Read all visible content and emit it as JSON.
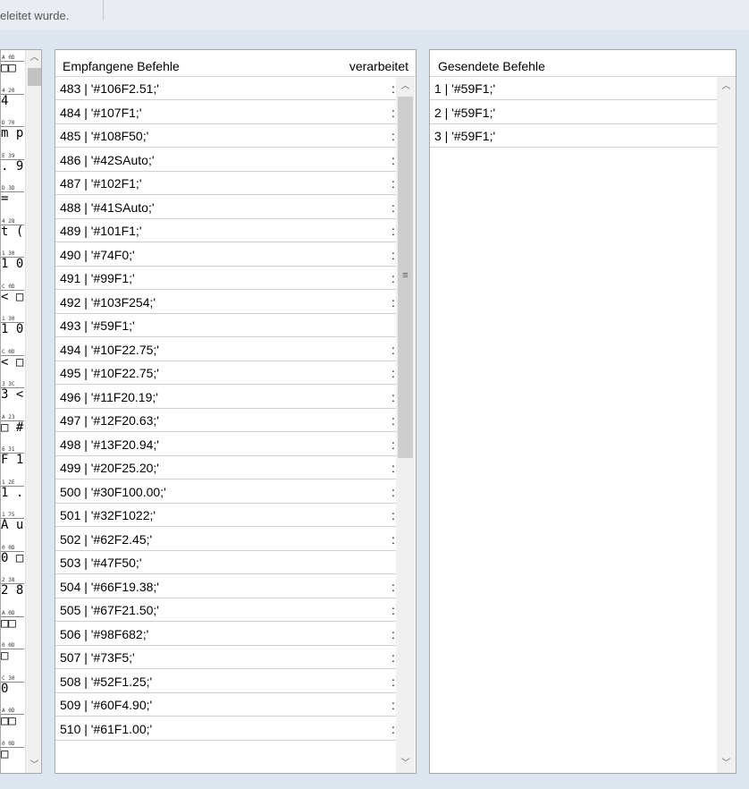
{
  "status_text": "eleitet wurde.",
  "hex_column": [
    {
      "hex": "A 0D",
      "char": "□□"
    },
    {
      "hex": "4 20",
      "char": "4"
    },
    {
      "hex": "D 70",
      "char": "m p"
    },
    {
      "hex": "E 39",
      "char": ". 9"
    },
    {
      "hex": "D 3D",
      "char": " ="
    },
    {
      "hex": "4 28",
      "char": "t ("
    },
    {
      "hex": "1 30",
      "char": "1 0"
    },
    {
      "hex": "C 0D",
      "char": "< □"
    },
    {
      "hex": "1 30",
      "char": "1 0"
    },
    {
      "hex": "C 0D",
      "char": "< □"
    },
    {
      "hex": "3 3C",
      "char": "3 <"
    },
    {
      "hex": "A 23",
      "char": "□ #"
    },
    {
      "hex": "6 31",
      "char": "F 1"
    },
    {
      "hex": "1 2E",
      "char": "1 ."
    },
    {
      "hex": "1 75",
      "char": "A u"
    },
    {
      "hex": "0 0D",
      "char": "0 □"
    },
    {
      "hex": "2 38",
      "char": "2 8"
    },
    {
      "hex": "A 0D",
      "char": "□□"
    },
    {
      "hex": "0 0D",
      "char": " □"
    },
    {
      "hex": "C 30",
      "char": " 0"
    },
    {
      "hex": "A 0D",
      "char": "□□"
    },
    {
      "hex": "0 0D",
      "char": " □"
    }
  ],
  "received": {
    "header_title": "Empfangene Befehle",
    "header_processed": "verarbeitet",
    "rows": [
      {
        "text": "483 | '#106F2.51;'",
        "processed": true
      },
      {
        "text": "484 | '#107F1;'",
        "processed": true
      },
      {
        "text": "485 | '#108F50;'",
        "processed": true
      },
      {
        "text": "486 | '#42SAuto;'",
        "processed": true
      },
      {
        "text": "487 | '#102F1;'",
        "processed": true
      },
      {
        "text": "488 | '#41SAuto;'",
        "processed": true
      },
      {
        "text": "489 | '#101F1;'",
        "processed": true
      },
      {
        "text": "490 | '#74F0;'",
        "processed": true
      },
      {
        "text": "491 | '#99F1;'",
        "processed": true
      },
      {
        "text": "492 | '#103F254;'",
        "processed": true
      },
      {
        "text": "493 | '#59F1;'",
        "processed": false
      },
      {
        "text": "494 | '#10F22.75;'",
        "processed": true
      },
      {
        "text": "495 | '#10F22.75;'",
        "processed": true
      },
      {
        "text": "496 | '#11F20.19;'",
        "processed": true
      },
      {
        "text": "497 | '#12F20.63;'",
        "processed": true
      },
      {
        "text": "498 | '#13F20.94;'",
        "processed": true
      },
      {
        "text": "499 | '#20F25.20;'",
        "processed": true
      },
      {
        "text": "500 | '#30F100.00;'",
        "processed": true
      },
      {
        "text": "501 | '#32F1022;'",
        "processed": true
      },
      {
        "text": "502 | '#62F2.45;'",
        "processed": true
      },
      {
        "text": "503 | '#47F50;'",
        "processed": false
      },
      {
        "text": "504 | '#66F19.38;'",
        "processed": true
      },
      {
        "text": "505 | '#67F21.50;'",
        "processed": true
      },
      {
        "text": "506 | '#98F682;'",
        "processed": true
      },
      {
        "text": "507 | '#73F5;'",
        "processed": true
      },
      {
        "text": "508 | '#52F1.25;'",
        "processed": true
      },
      {
        "text": "509 | '#60F4.90;'",
        "processed": true
      },
      {
        "text": "510 | '#61F1.00;'",
        "processed": true
      }
    ],
    "trail_mark": ":"
  },
  "sent": {
    "header_title": "Gesendete Befehle",
    "rows": [
      {
        "text": "1 | '#59F1;'"
      },
      {
        "text": "2 | '#59F1;'"
      },
      {
        "text": "3 | '#59F1;'"
      }
    ]
  },
  "icons": {
    "scroll_up": "chevron-up-icon",
    "scroll_down": "chevron-down-icon",
    "grip": "grip-icon"
  }
}
